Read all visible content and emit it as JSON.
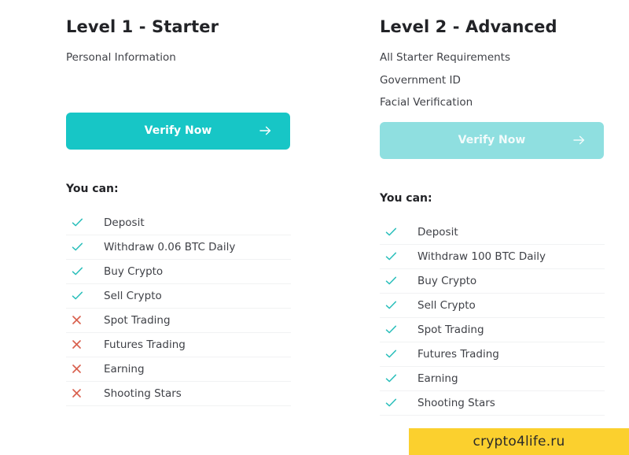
{
  "columns": [
    {
      "title": "Level 1 - Starter",
      "requirements": [
        "Personal Information"
      ],
      "button": {
        "label": "Verify Now",
        "icon": "arrow-right-icon",
        "state": "active",
        "color": "#17c6c6",
        "text_color": "#ffffff"
      },
      "features_heading": "You can:",
      "features": [
        {
          "label": "Deposit",
          "icon": "check-icon",
          "allowed": true
        },
        {
          "label": "Withdraw 0.06 BTC Daily",
          "icon": "check-icon",
          "allowed": true
        },
        {
          "label": "Buy Crypto",
          "icon": "check-icon",
          "allowed": true
        },
        {
          "label": "Sell Crypto",
          "icon": "check-icon",
          "allowed": true
        },
        {
          "label": "Spot Trading",
          "icon": "cross-icon",
          "allowed": false
        },
        {
          "label": "Futures Trading",
          "icon": "cross-icon",
          "allowed": false
        },
        {
          "label": "Earning",
          "icon": "cross-icon",
          "allowed": false
        },
        {
          "label": "Shooting Stars",
          "icon": "cross-icon",
          "allowed": false
        }
      ]
    },
    {
      "title": "Level 2 - Advanced",
      "requirements": [
        "All Starter Requirements",
        "Government ID",
        "Facial Verification"
      ],
      "button": {
        "label": "Verify Now",
        "icon": "arrow-right-icon",
        "state": "disabled",
        "color": "#8fdfe0",
        "text_color": "#f2fbfb"
      },
      "features_heading": "You can:",
      "features": [
        {
          "label": "Deposit",
          "icon": "check-icon",
          "allowed": true
        },
        {
          "label": "Withdraw 100 BTC Daily",
          "icon": "check-icon",
          "allowed": true
        },
        {
          "label": "Buy Crypto",
          "icon": "check-icon",
          "allowed": true
        },
        {
          "label": "Sell Crypto",
          "icon": "check-icon",
          "allowed": true
        },
        {
          "label": "Spot Trading",
          "icon": "check-icon",
          "allowed": true
        },
        {
          "label": "Futures Trading",
          "icon": "check-icon",
          "allowed": true
        },
        {
          "label": "Earning",
          "icon": "check-icon",
          "allowed": true
        },
        {
          "label": "Shooting Stars",
          "icon": "check-icon",
          "allowed": true
        }
      ]
    }
  ],
  "watermark": {
    "text": "crypto4life.ru",
    "background": "#fbd02e",
    "text_color": "#2a2a2a"
  },
  "palette": {
    "check_color": "#2bbfbb",
    "cross_color": "#d9614f",
    "heading_color": "#222327",
    "body_text_color": "#3f4147",
    "separator_color": "#f1f2f3"
  }
}
